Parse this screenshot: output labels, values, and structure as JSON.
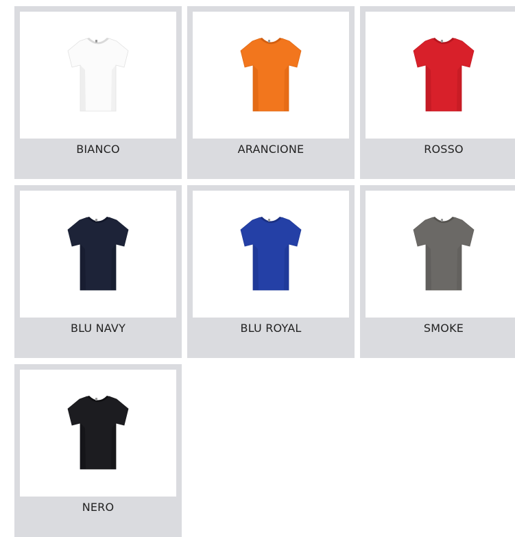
{
  "colors": [
    {
      "name": "BIANCO",
      "shirt": "#fbfbfb",
      "shade": "#e4e4e4",
      "collar": "#d9d9d9",
      "outline": "#e1e1e1"
    },
    {
      "name": "ARANCIONE",
      "shirt": "#f2761d",
      "shade": "#d9620f",
      "collar": "#d25e10",
      "outline": "#e06a15"
    },
    {
      "name": "ROSSO",
      "shirt": "#d8202a",
      "shade": "#b81820",
      "collar": "#b5161f",
      "outline": "#c51b24"
    },
    {
      "name": "BLU NAVY",
      "shirt": "#1d2338",
      "shade": "#141a2b",
      "collar": "#12172a",
      "outline": "#1a2033"
    },
    {
      "name": "BLU ROYAL",
      "shirt": "#2440a6",
      "shade": "#1b338c",
      "collar": "#1a2f82",
      "outline": "#213b99"
    },
    {
      "name": "SMOKE",
      "shirt": "#6b6966",
      "shade": "#5a5855",
      "collar": "#55534f",
      "outline": "#63615e"
    },
    {
      "name": "NERO",
      "shirt": "#1c1c20",
      "shade": "#111114",
      "collar": "#0f0f12",
      "outline": "#1a1a1d"
    }
  ]
}
